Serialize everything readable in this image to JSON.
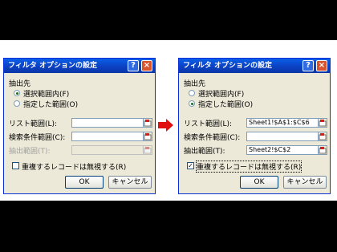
{
  "left": {
    "title": "フィルタ オプションの設定",
    "extract_section": "抽出先",
    "opt_in_place": "選択範囲内(F)",
    "opt_copy": "指定した範囲(O)",
    "list_range_label": "リスト範囲(L):",
    "list_range_value": "",
    "criteria_label": "検索条件範囲(C):",
    "criteria_value": "",
    "extract_range_label": "抽出範囲(T):",
    "extract_range_value": "",
    "unique_label": "重複するレコードは無視する(R)",
    "ok": "OK",
    "cancel": "キャンセル"
  },
  "right": {
    "title": "フィルタ オプションの設定",
    "extract_section": "抽出先",
    "opt_in_place": "選択範囲内(F)",
    "opt_copy": "指定した範囲(O)",
    "list_range_label": "リスト範囲(L):",
    "list_range_value": "Sheet1!$A$1:$C$6",
    "criteria_label": "検索条件範囲(C):",
    "criteria_value": "",
    "extract_range_label": "抽出範囲(T):",
    "extract_range_value": "Sheet2!$C$2",
    "unique_label": "重複するレコードは無視する(R)",
    "ok": "OK",
    "cancel": "キャンセル"
  },
  "colors": {
    "arrow": "#e01010",
    "titlebar": "#0a4fd6",
    "dialog_bg": "#ece9d8"
  },
  "state": {
    "left_selected_option": "in_place",
    "right_selected_option": "copy",
    "left_unique_checked": false,
    "right_unique_checked": true
  }
}
